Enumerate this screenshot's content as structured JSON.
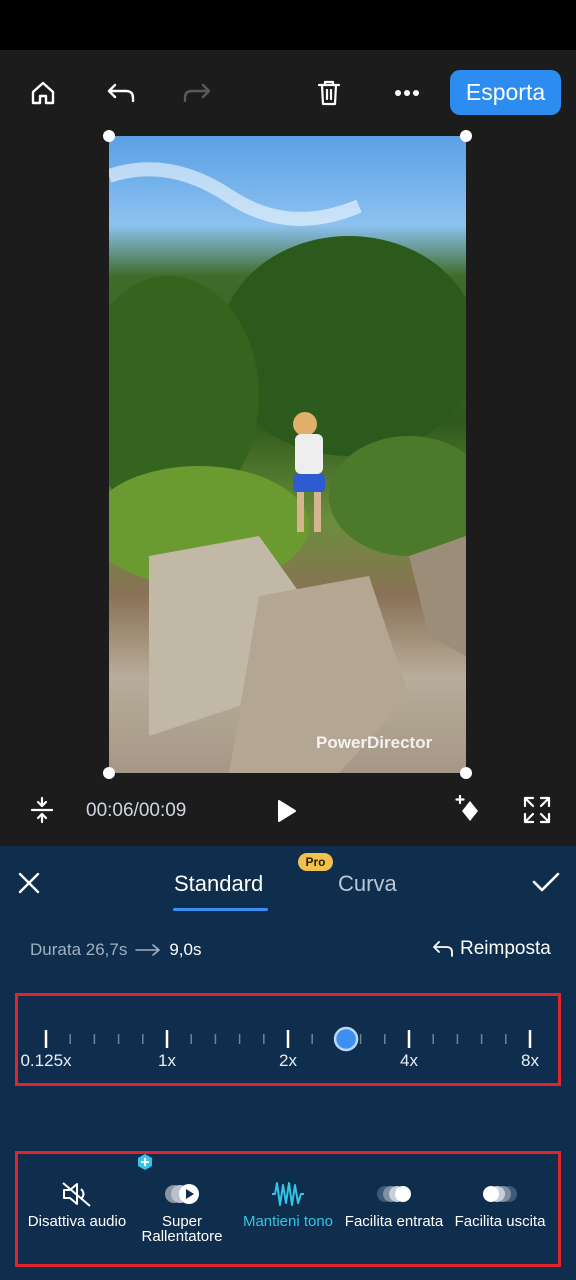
{
  "toolbar": {
    "home_icon": "home-icon",
    "undo_icon": "undo-icon",
    "redo_icon": "redo-icon",
    "delete_icon": "trash-icon",
    "more_icon": "more-icon",
    "export_label": "Esporta"
  },
  "preview": {
    "watermark": "PowerDirector"
  },
  "playback": {
    "timecode": "00:06/00:09",
    "play_icon": "play-icon",
    "split_icon": "split-icon",
    "keyframe_icon": "keyframe-icon",
    "fullscreen_icon": "fullscreen-icon"
  },
  "speed_panel": {
    "tabs": [
      {
        "label": "Standard",
        "active": true
      },
      {
        "label": "Curva",
        "active": false,
        "badge": "Pro"
      }
    ],
    "duration_label": "Durata 26,7s",
    "new_duration": "9,0s",
    "reset_label": "Reimposta",
    "slider": {
      "ticks": [
        "0.125x",
        "1x",
        "2x",
        "4x",
        "8x"
      ],
      "value_position": 0.62
    },
    "options": [
      {
        "label": "Disattiva audio",
        "icon": "mute-icon",
        "active": false
      },
      {
        "label": "Super Rallentatore",
        "line1": "Super",
        "line2": "Rallentatore",
        "icon": "super-slowmo-icon",
        "active": false
      },
      {
        "label": "Mantieni tono",
        "icon": "pitch-icon",
        "active": true
      },
      {
        "label": "Facilita entrata",
        "icon": "ease-in-icon",
        "active": false
      },
      {
        "label": "Facilita uscita",
        "icon": "ease-out-icon",
        "active": false
      }
    ]
  },
  "colors": {
    "accent": "#2d8cf0",
    "panel": "#0f2d4d",
    "highlight": "#e0242c",
    "active_option": "#33c4e8"
  }
}
